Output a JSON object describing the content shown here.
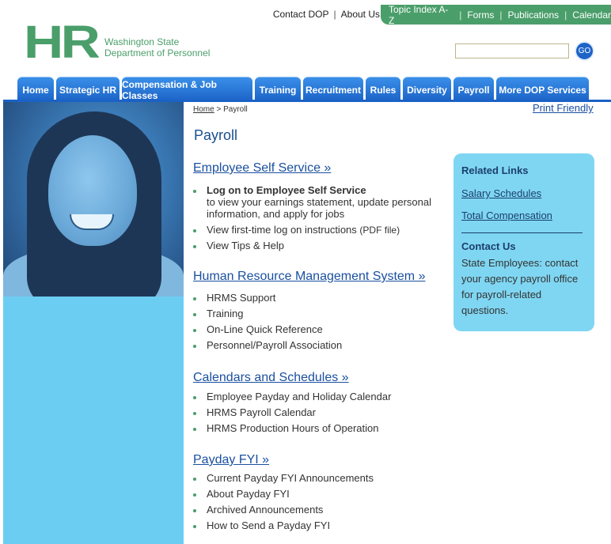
{
  "utility": {
    "contact": "Contact DOP",
    "about": "About Us",
    "green_links": [
      "Topic Index A-Z",
      "Forms",
      "Publications",
      "Calendar"
    ],
    "separator": "|"
  },
  "logo": {
    "mark": "HR",
    "line1": "Washington State",
    "line2": "Department of Personnel"
  },
  "search": {
    "value": "",
    "go_label": "GO"
  },
  "nav": {
    "tabs": [
      "Home",
      "Strategic HR",
      "Compensation & Job Classes",
      "Training",
      "Recruitment",
      "Rules",
      "Diversity",
      "Payroll",
      "More DOP Services"
    ]
  },
  "breadcrumb": {
    "home": "Home",
    "separator": " > ",
    "current": "Payroll"
  },
  "print_friendly": "Print Friendly",
  "page_title": "Payroll",
  "sections": {
    "ess": {
      "heading": "Employee Self Service »",
      "item1_bold": "Log on to Employee Self Service",
      "item1_link": "to view your earnings statement, update personal information, and apply for jobs",
      "item2": "View first-time log on instructions",
      "item2_note": "(PDF file)",
      "item3": "View Tips & Help"
    },
    "hrms": {
      "heading": "Human Resource Management System »",
      "items": [
        "HRMS Support",
        "Training",
        "On-Line Quick Reference",
        "Personnel/Payroll Association"
      ]
    },
    "calendars": {
      "heading": "Calendars and Schedules »",
      "items": [
        "Employee Payday and Holiday Calendar",
        "HRMS Payroll Calendar",
        "HRMS Production Hours of Operation"
      ]
    },
    "fyi": {
      "heading": "Payday FYI »",
      "items": [
        "Current Payday FYI Announcements",
        "About Payday FYI",
        "Archived Announcements",
        "How to Send a Payday FYI"
      ]
    }
  },
  "sidebar": {
    "related_heading": "Related Links",
    "link1": "Salary Schedules",
    "link2": "Total Compensation",
    "contact_heading": "Contact Us",
    "contact_text": "State Employees: contact your agency payroll office for payroll-related questions."
  },
  "colors": {
    "brand_green": "#4a9e6a",
    "nav_blue": "#1a62c6",
    "left_panel": "#6ccdf2",
    "sidebar_box": "#7fd6f2",
    "link_blue": "#1a4f9f"
  }
}
